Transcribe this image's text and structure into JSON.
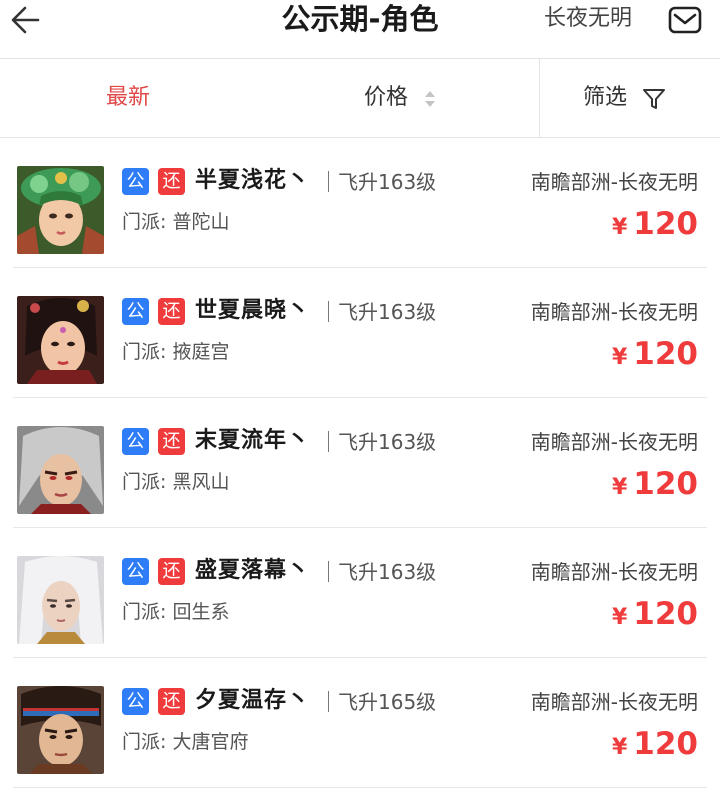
{
  "header": {
    "title": "公示期-角色",
    "server": "长夜无明",
    "back_icon": "back-arrow-icon",
    "mail_icon": "mail-icon"
  },
  "sortbar": {
    "latest": "最新",
    "price": "价格",
    "filter": "筛选",
    "active_color": "#e04848"
  },
  "colors": {
    "badge_public": "#2e7cf6",
    "badge_return": "#ef3b3b",
    "price": "#ef3b3b"
  },
  "items": [
    {
      "badge_public": "公",
      "badge_return": "还",
      "name": "半夏浅花丶",
      "level": "飞升163级",
      "region": "南瞻部洲-长夜无明",
      "school": "门派: 普陀山",
      "currency": "¥",
      "price": "120"
    },
    {
      "badge_public": "公",
      "badge_return": "还",
      "name": "世夏晨晓丶",
      "level": "飞升163级",
      "region": "南瞻部洲-长夜无明",
      "school": "门派: 掖庭宫",
      "currency": "¥",
      "price": "120"
    },
    {
      "badge_public": "公",
      "badge_return": "还",
      "name": "末夏流年丶",
      "level": "飞升163级",
      "region": "南瞻部洲-长夜无明",
      "school": "门派: 黑风山",
      "currency": "¥",
      "price": "120"
    },
    {
      "badge_public": "公",
      "badge_return": "还",
      "name": "盛夏落幕丶",
      "level": "飞升163级",
      "region": "南瞻部洲-长夜无明",
      "school": "门派: 回生系",
      "currency": "¥",
      "price": "120"
    },
    {
      "badge_public": "公",
      "badge_return": "还",
      "name": "夕夏温存丶",
      "level": "飞升165级",
      "region": "南瞻部洲-长夜无明",
      "school": "门派: 大唐官府",
      "currency": "¥",
      "price": "120"
    }
  ]
}
